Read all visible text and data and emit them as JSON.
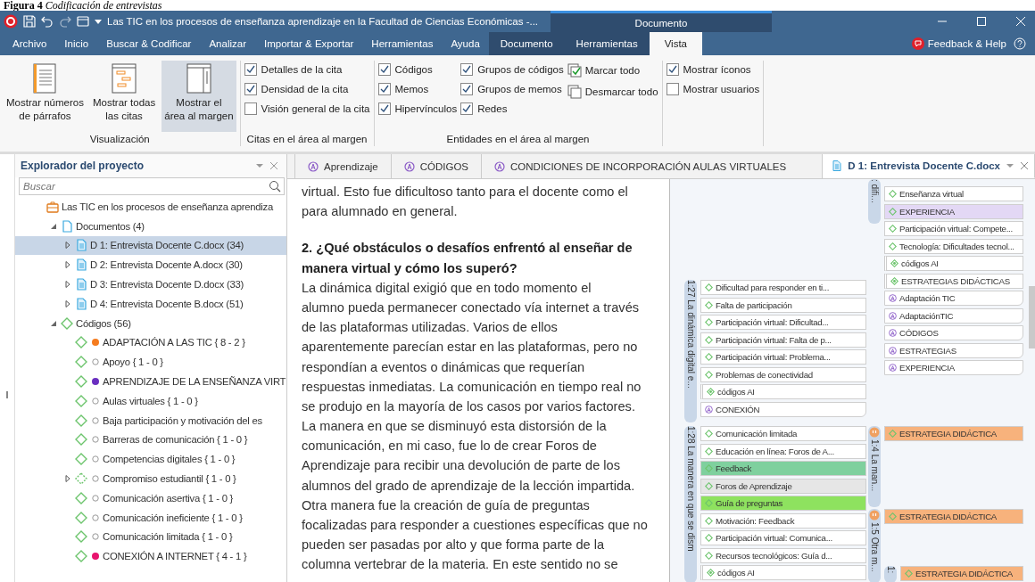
{
  "caption": {
    "label": "Figura 4",
    "title": "Codificación de entrevistas"
  },
  "title_bar": {
    "title": "Las TIC en los procesos de enseñanza aprendizaje en la Facultad de Ciencias Económicas -...",
    "context_tab": "Documento"
  },
  "menu": [
    {
      "label": "Archivo",
      "selected": false,
      "context": false
    },
    {
      "label": "Inicio",
      "selected": false,
      "context": false
    },
    {
      "label": "Buscar & Codificar",
      "selected": false,
      "context": false
    },
    {
      "label": "Analizar",
      "selected": false,
      "context": false
    },
    {
      "label": "Importar & Exportar",
      "selected": false,
      "context": false
    },
    {
      "label": "Herramientas",
      "selected": false,
      "context": false
    },
    {
      "label": "Ayuda",
      "selected": false,
      "context": false
    },
    {
      "label": "Documento",
      "selected": false,
      "context": true
    },
    {
      "label": "Herramientas",
      "selected": false,
      "context": true
    },
    {
      "label": "Vista",
      "selected": true,
      "context": true
    }
  ],
  "help": "Feedback & Help",
  "ribbon": [
    {
      "title": "Visualización",
      "kind": "buttons",
      "items": [
        {
          "lines": [
            "Mostrar números",
            "de párrafos"
          ],
          "selected": false
        },
        {
          "lines": [
            "Mostrar todas",
            "las citas"
          ],
          "selected": false
        },
        {
          "lines": [
            "Mostrar el",
            "área al margen"
          ],
          "selected": true
        }
      ]
    },
    {
      "title": "Citas en el área al margen",
      "kind": "checks",
      "columns": [
        [
          {
            "label": "Detalles de la cita",
            "kind": "check",
            "checked": true
          },
          {
            "label": "Densidad de la cita",
            "kind": "check",
            "checked": true
          },
          {
            "label": "Visión general de la cita",
            "kind": "check",
            "checked": false
          }
        ]
      ]
    },
    {
      "title": "Entidades en el área al margen",
      "kind": "checks",
      "columns": [
        [
          {
            "label": "Códigos",
            "kind": "check",
            "checked": true
          },
          {
            "label": "Memos",
            "kind": "check",
            "checked": true
          },
          {
            "label": "Hipervínculos",
            "kind": "check",
            "checked": true
          }
        ],
        [
          {
            "label": "Grupos de códigos",
            "kind": "check",
            "checked": true
          },
          {
            "label": "Grupos de memos",
            "kind": "check",
            "checked": true
          },
          {
            "label": "Redes",
            "kind": "check",
            "checked": true
          }
        ],
        [
          {
            "label": "Marcar todo",
            "kind": "action",
            "checked": true
          },
          {
            "label": "Desmarcar todo",
            "kind": "action",
            "checked": false
          }
        ]
      ]
    },
    {
      "kind": "checks",
      "columns": [
        [
          {
            "label": "Mostrar íconos",
            "kind": "check",
            "checked": true
          },
          {
            "label": "Mostrar usuarios",
            "kind": "check",
            "checked": false
          }
        ]
      ]
    }
  ],
  "explorer": {
    "title": "Explorador del proyecto",
    "placeholder": "Buscar",
    "tree": [
      {
        "label": "Las TIC en los procesos de enseñanza aprendiza",
        "kind": "project",
        "selected": false,
        "children": [
          {
            "label": "Documentos (4)",
            "kind": "folder",
            "expanded": true,
            "selected": false,
            "children": [
              {
                "label": "D 1: Entrevista Docente C.docx (34)",
                "kind": "doc",
                "expanded": false,
                "selected": true
              },
              {
                "label": "D 2: Entrevista Docente A.docx (30)",
                "kind": "doc",
                "expanded": false,
                "selected": false
              },
              {
                "label": "D 3: Entrevista Docente D.docx (33)",
                "kind": "doc",
                "expanded": false,
                "selected": false
              },
              {
                "label": "D 4: Entrevista Docente B.docx (51)",
                "kind": "doc",
                "expanded": false,
                "selected": false
              }
            ]
          },
          {
            "label": "Códigos (56)",
            "kind": "codes",
            "expanded": true,
            "selected": false,
            "children": [
              {
                "label": "ADAPTACIÓN A LAS TIC { 8 - 2 }",
                "kind": "code",
                "color": "#f57c1f",
                "selected": false
              },
              {
                "label": "Apoyo { 1 - 0 }",
                "kind": "code",
                "selected": false
              },
              {
                "label": "APRENDIZAJE DE LA ENSEÑANZA VIRT",
                "kind": "code",
                "color": "#6a2fc0",
                "selected": false
              },
              {
                "label": "Aulas virtuales { 1 - 0 }",
                "kind": "code",
                "selected": false
              },
              {
                "label": "Baja participación y motivación del es",
                "kind": "code",
                "selected": false
              },
              {
                "label": "Barreras de comunicación { 1 - 0 }",
                "kind": "code",
                "selected": false
              },
              {
                "label": "Competencias digitales { 1 - 0 }",
                "kind": "code",
                "selected": false
              },
              {
                "label": "Compromiso estudiantil { 1 - 0 }",
                "kind": "code",
                "expanded": false,
                "selected": false
              },
              {
                "label": "Comunicación asertiva { 1 - 0 }",
                "kind": "code",
                "selected": false
              },
              {
                "label": "Comunicación ineficiente { 1 - 0 }",
                "kind": "code",
                "selected": false
              },
              {
                "label": "Comunicación limitada { 1 - 0 }",
                "kind": "code",
                "selected": false
              },
              {
                "label": "CONEXIÓN A INTERNET { 4 - 1 }",
                "kind": "code",
                "color": "#e8146e",
                "selected": false
              }
            ]
          }
        ]
      }
    ]
  },
  "doc_tabs": [
    {
      "label": "Aprendizaje",
      "kind": "network",
      "selected": false
    },
    {
      "label": "CÓDIGOS",
      "kind": "network",
      "selected": false
    },
    {
      "label": "CONDICIONES DE INCORPORACIÓN AULAS VIRTUALES",
      "kind": "network",
      "selected": false
    },
    {
      "label": "D 1: Entrevista Docente C.docx",
      "kind": "doc",
      "selected": true
    }
  ],
  "document": [
    {
      "kind": "body",
      "lines": [
        "virtual. Esto fue dificultoso tanto para el docente como el",
        "para alumnado en general."
      ]
    },
    {
      "kind": "heading",
      "lines": [
        "2. ¿Qué obstáculos o desafíos enfrentó al enseñar de",
        "manera virtual y cómo los superó?"
      ]
    },
    {
      "kind": "body",
      "lines": [
        "La dinámica digital exigió que en todo momento el",
        "alumno pueda permanecer conectado vía internet a través",
        "de las plataformas utilizadas. Varios de ellos",
        "aparentemente parecían estar en las plataformas, pero no",
        "respondían a eventos o dinámicas que requerían",
        "respuestas inmediatas. La comunicación en tiempo real no",
        "se produjo en la mayoría de los casos por varios factores.",
        "La manera en que se disminuyó esta distorsión de la",
        "comunicación, en mi caso, fue lo de crear Foros de",
        "Aprendizaje para recibir una devolución de parte de los",
        "alumnos del grado de aprendizaje de la lección impartida.",
        "Otra manera fue la creación de guía de preguntas",
        "focalizadas para responder a cuestiones específicas que no",
        "pueden ser pasadas por alto y que forma parte de la",
        "columna vertebrar de la materia. En este sentido no se"
      ]
    }
  ],
  "margin": [
    {
      "label": ": difi...",
      "badge": false,
      "codes": [
        {
          "name": "Enseñanza virtual",
          "kind": "code"
        },
        {
          "name": "EXPERIENCIA",
          "kind": "code",
          "color": "#e3d8f5"
        },
        {
          "name": "Participación virtual: Compete...",
          "kind": "code"
        },
        {
          "name": "Tecnología: Dificultades tecnol...",
          "kind": "code"
        },
        {
          "name": "códigos AI",
          "kind": "group"
        },
        {
          "name": "ESTRATEGIAS DIDÁCTICAS",
          "kind": "group"
        },
        {
          "name": "Adaptación TIC",
          "kind": "network"
        },
        {
          "name": "AdaptaciónTIC",
          "kind": "network"
        },
        {
          "name": "CÓDIGOS",
          "kind": "network"
        },
        {
          "name": "ESTRATEGIAS",
          "kind": "network"
        },
        {
          "name": "EXPERIENCIA",
          "kind": "network"
        }
      ]
    },
    {
      "label": "1:27 La dinámica digital e...",
      "badge": false,
      "codes": [
        {
          "name": "Dificultad para responder en ti...",
          "kind": "code"
        },
        {
          "name": "Falta de participación",
          "kind": "code"
        },
        {
          "name": "Participación virtual: Dificultad...",
          "kind": "code"
        },
        {
          "name": "Participación virtual: Falta de p...",
          "kind": "code"
        },
        {
          "name": "Participación virtual: Problema...",
          "kind": "code"
        },
        {
          "name": "Problemas de conectividad",
          "kind": "code"
        },
        {
          "name": "códigos AI",
          "kind": "group"
        },
        {
          "name": "CONEXIÓN",
          "kind": "network"
        }
      ]
    },
    {
      "label": "1:28 La manera en que se dism",
      "badge": false,
      "codes": [
        {
          "name": "Comunicación limitada",
          "kind": "code"
        },
        {
          "name": "Educación en línea: Foros de A...",
          "kind": "code"
        },
        {
          "name": "Feedback",
          "kind": "code",
          "color": "#7fd09e"
        },
        {
          "name": "Foros de Aprendizaje",
          "kind": "code",
          "color": "#e6e6e6"
        },
        {
          "name": "Guía de preguntas",
          "kind": "code",
          "color": "#8ee25f"
        },
        {
          "name": "Motivación: Feedback",
          "kind": "code"
        },
        {
          "name": "Participación virtual: Comunica...",
          "kind": "code"
        },
        {
          "name": "Recursos tecnológicos: Guía d...",
          "kind": "code"
        },
        {
          "name": "códigos AI",
          "kind": "group"
        }
      ]
    },
    {
      "label": "1:4 La man...",
      "badge": true,
      "codes": [
        {
          "name": "ESTRATEGIA DIDÁCTICA",
          "kind": "code",
          "color": "#f7b27c"
        }
      ]
    },
    {
      "label": "1:5 Otra m...",
      "badge": true,
      "codes": [
        {
          "name": "ESTRATEGIA DIDÁCTICA",
          "kind": "code",
          "color": "#f7b27c"
        }
      ]
    },
    {
      "label": "1:",
      "badge": false,
      "codes": [
        {
          "name": "ESTRATEGIA DIDÁCTICA",
          "kind": "code",
          "color": "#f7b27c"
        }
      ]
    }
  ]
}
